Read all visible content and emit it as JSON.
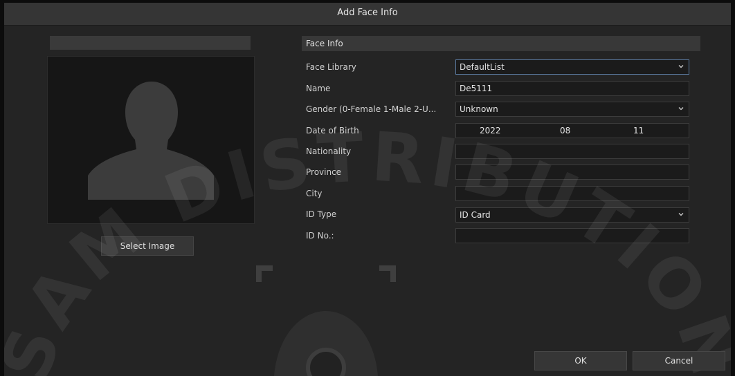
{
  "dialog": {
    "title": "Add Face Info",
    "select_image_label": "Select Image",
    "ok_label": "OK",
    "cancel_label": "Cancel"
  },
  "form": {
    "section_title": "Face Info",
    "face_library": {
      "label": "Face Library",
      "value": "DefaultList"
    },
    "name": {
      "label": "Name",
      "value": "De5111"
    },
    "gender": {
      "label": "Gender (0-Female 1-Male 2-U...",
      "value": "Unknown"
    },
    "dob": {
      "label": "Date of Birth",
      "year": "2022",
      "month": "08",
      "day": "11"
    },
    "nationality": {
      "label": "Nationality",
      "value": ""
    },
    "province": {
      "label": "Province",
      "value": ""
    },
    "city": {
      "label": "City",
      "value": ""
    },
    "id_type": {
      "label": "ID Type",
      "value": "ID Card"
    },
    "id_no": {
      "label": "ID No.:",
      "value": ""
    }
  },
  "watermark": {
    "text": "SAM DISTRIBUTION"
  },
  "icons": [
    "chevron-down-icon",
    "silhouette-icon",
    "camera-logo-icon"
  ],
  "colors": {
    "background": "#242424",
    "titlebar": "#353535",
    "focus_border": "#5b7aa0"
  }
}
